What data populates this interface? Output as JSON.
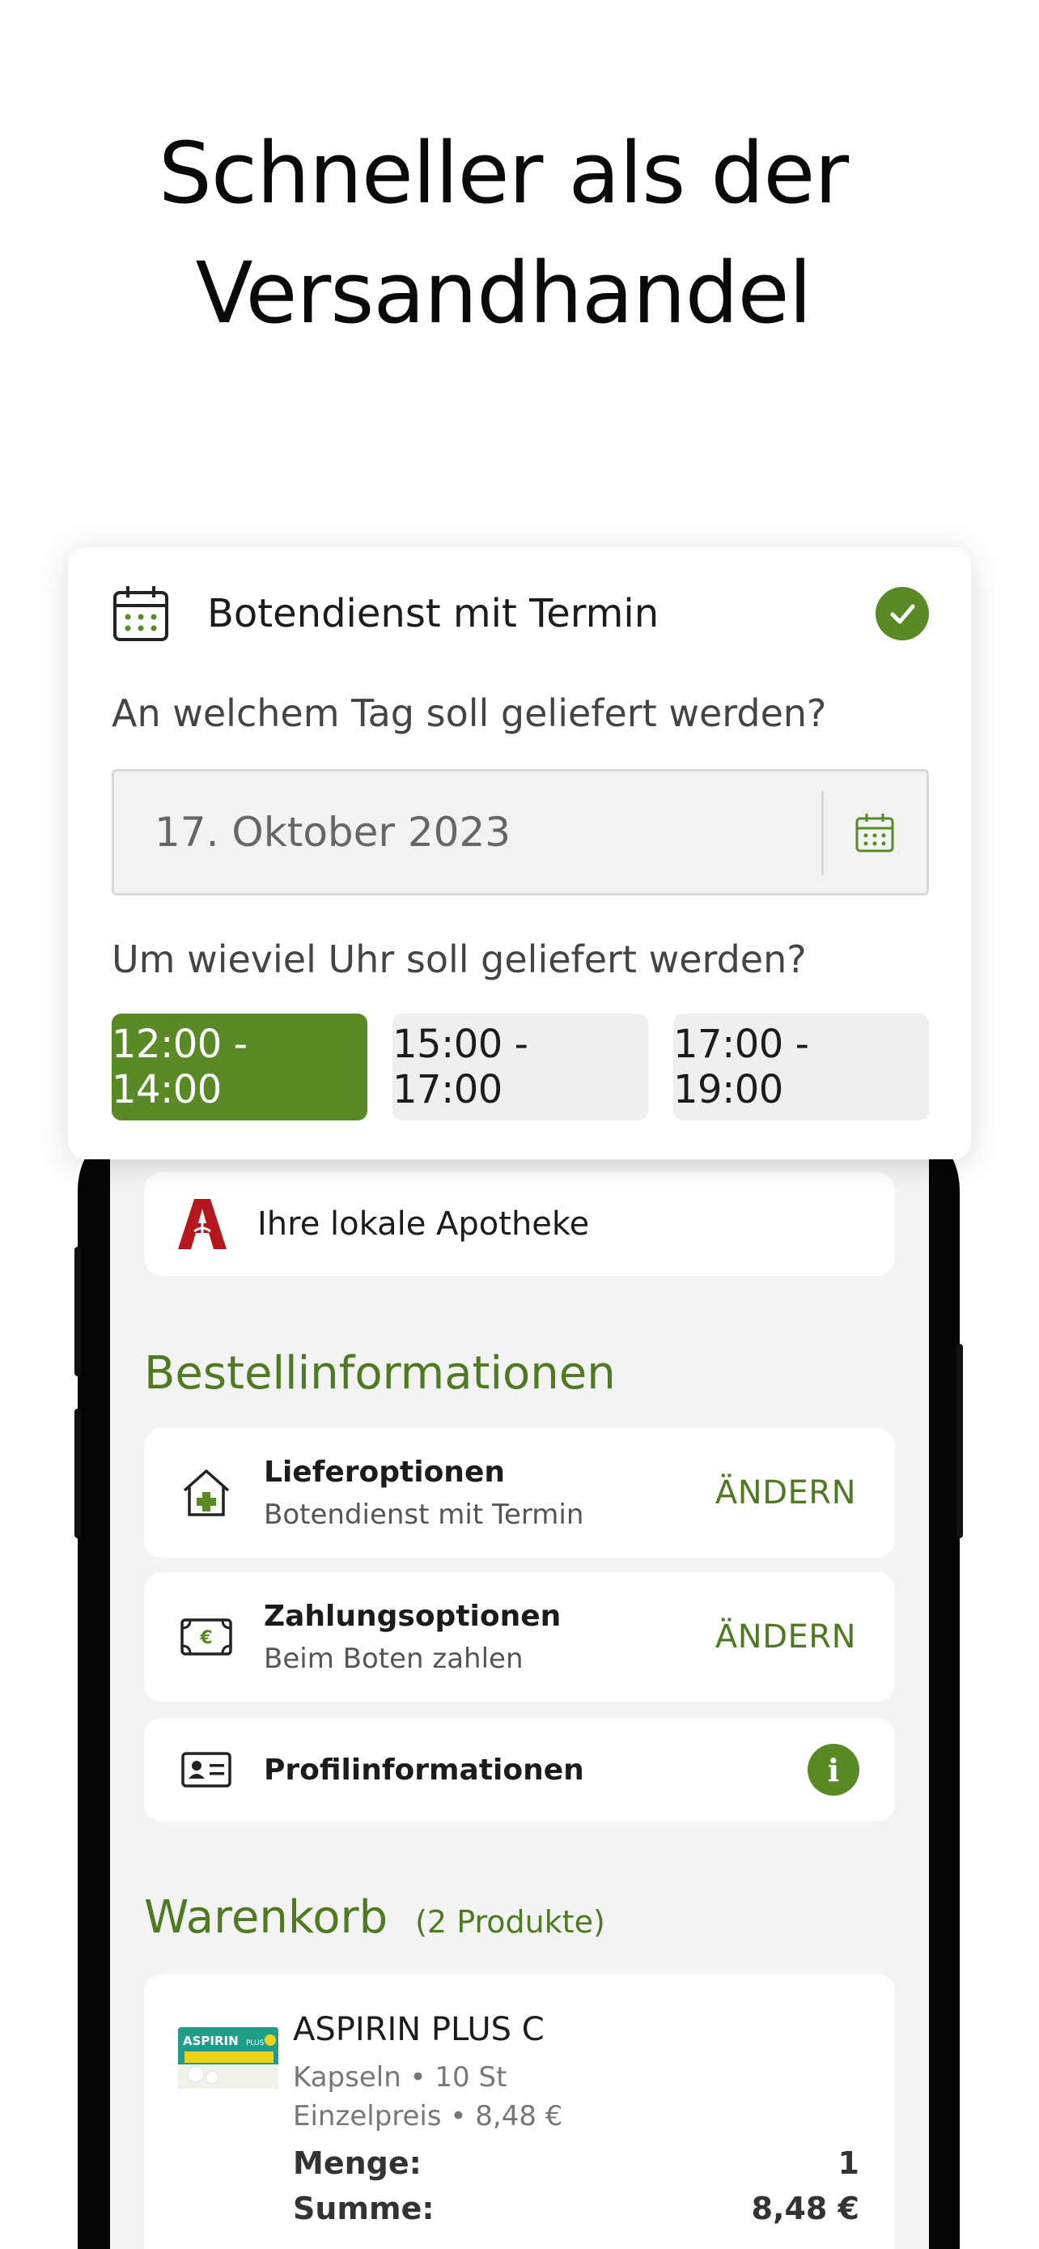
{
  "headline": {
    "line1": "Schneller als der",
    "line2": "Versandhandel"
  },
  "delivery_card": {
    "title": "Botendienst mit Termin",
    "day_question": "An welchem Tag soll geliefert werden?",
    "date_value": "17. Oktober 2023",
    "time_question": "Um wieviel Uhr soll geliefert werden?",
    "slots": [
      {
        "label": "12:00 - 14:00",
        "selected": true
      },
      {
        "label": "15:00 - 17:00",
        "selected": false
      },
      {
        "label": "17:00 - 19:00",
        "selected": false
      }
    ]
  },
  "pharmacy": {
    "label": "Ihre lokale Apotheke"
  },
  "order_info": {
    "title": "Bestellinformationen",
    "delivery": {
      "title": "Lieferoptionen",
      "value": "Botendienst mit Termin",
      "action": "ÄNDERN"
    },
    "payment": {
      "title": "Zahlungsoptionen",
      "value": "Beim Boten zahlen",
      "action": "ÄNDERN"
    },
    "profile": {
      "title": "Profilinformationen"
    }
  },
  "cart": {
    "title": "Warenkorb",
    "count": "(2 Produkte)",
    "items": [
      {
        "name": "ASPIRIN PLUS C",
        "form": "Kapseln • 10 St",
        "unit_price": "Einzelpreis • 8,48 €",
        "qty_label": "Menge:",
        "qty": "1",
        "sum_label": "Summe:",
        "sum": "8,48 €",
        "image_text": "ASPIRIN PLUS C"
      }
    ]
  },
  "colors": {
    "accent": "#5a8a25",
    "accent_text": "#4f7a22",
    "pharmacy_red": "#b4181e"
  }
}
